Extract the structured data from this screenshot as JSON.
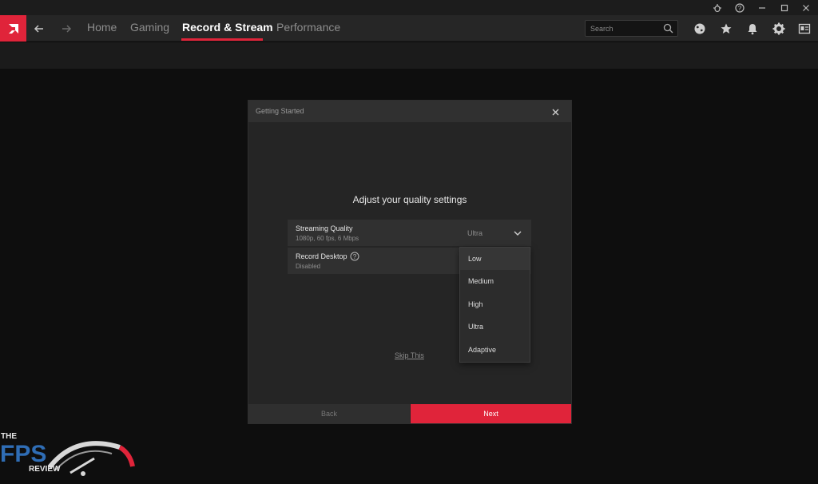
{
  "window_controls": {
    "icons": [
      "bug-icon",
      "help-icon",
      "minimize-icon",
      "maximize-icon",
      "close-icon"
    ]
  },
  "nav": {
    "tabs": [
      {
        "label": "Home",
        "active": false
      },
      {
        "label": "Gaming",
        "active": false
      },
      {
        "label": "Record & Stream",
        "active": true
      },
      {
        "label": "Performance",
        "active": false
      }
    ],
    "search_placeholder": "Search",
    "right_icons": [
      "globe-icon",
      "star-icon",
      "bell-icon",
      "gear-icon",
      "account-icon"
    ],
    "accent_color": "#e0243a"
  },
  "dialog": {
    "title": "Getting Started",
    "heading": "Adjust your quality settings",
    "rows": [
      {
        "label": "Streaming Quality",
        "sub": "1080p, 60 fps, 6 Mbps",
        "value": "Ultra"
      },
      {
        "label": "Record Desktop",
        "sub": "Disabled"
      }
    ],
    "dropdown_options": [
      "Low",
      "Medium",
      "High",
      "Ultra",
      "Adaptive"
    ],
    "dropdown_highlighted": "Low",
    "skip_label": "Skip This",
    "back_label": "Back",
    "next_label": "Next"
  },
  "watermark": {
    "line1": "THE",
    "line2": "FPS",
    "line3": "REVIEW"
  }
}
